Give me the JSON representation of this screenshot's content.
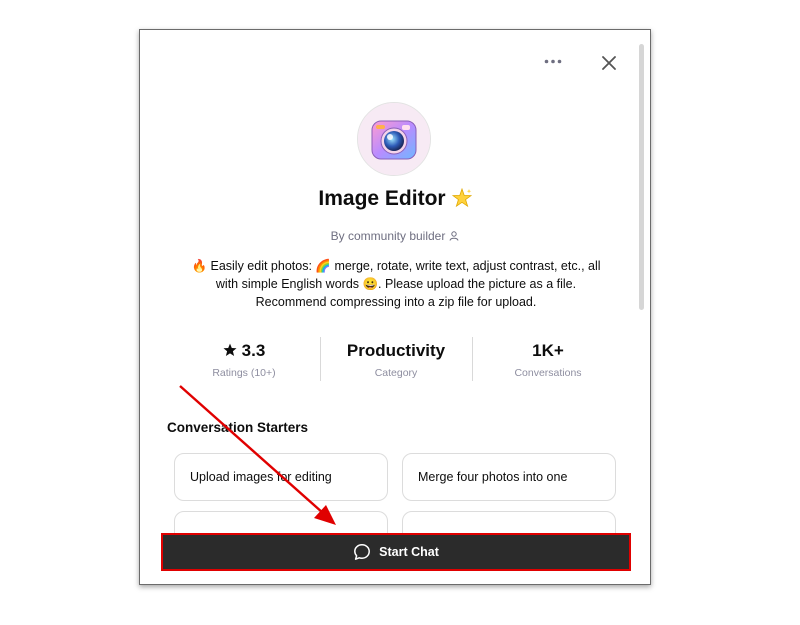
{
  "header": {
    "more_icon": "more-horizontal-icon",
    "close_icon": "close-icon"
  },
  "gpt": {
    "name": "Image Editor",
    "author": "By community builder",
    "description_lines": [
      "🔥 Easily edit photos: 🌈 merge, rotate, write text, adjust contrast, etc., all",
      "with simple English words 😀. Please upload the picture as a file.",
      "Recommend compressing into a zip file for upload."
    ]
  },
  "stats": [
    {
      "value": "3.3",
      "label": "Ratings (10+)"
    },
    {
      "value": "Productivity",
      "label": "Category"
    },
    {
      "value": "1K+",
      "label": "Conversations"
    }
  ],
  "starters": {
    "title": "Conversation Starters",
    "items": [
      "Upload images for editing",
      "Merge four photos into one",
      "",
      ""
    ]
  },
  "start_chat": {
    "label": "Start Chat"
  },
  "colors": {
    "highlight": "#e00000",
    "button_bg": "#2b2b2b"
  }
}
